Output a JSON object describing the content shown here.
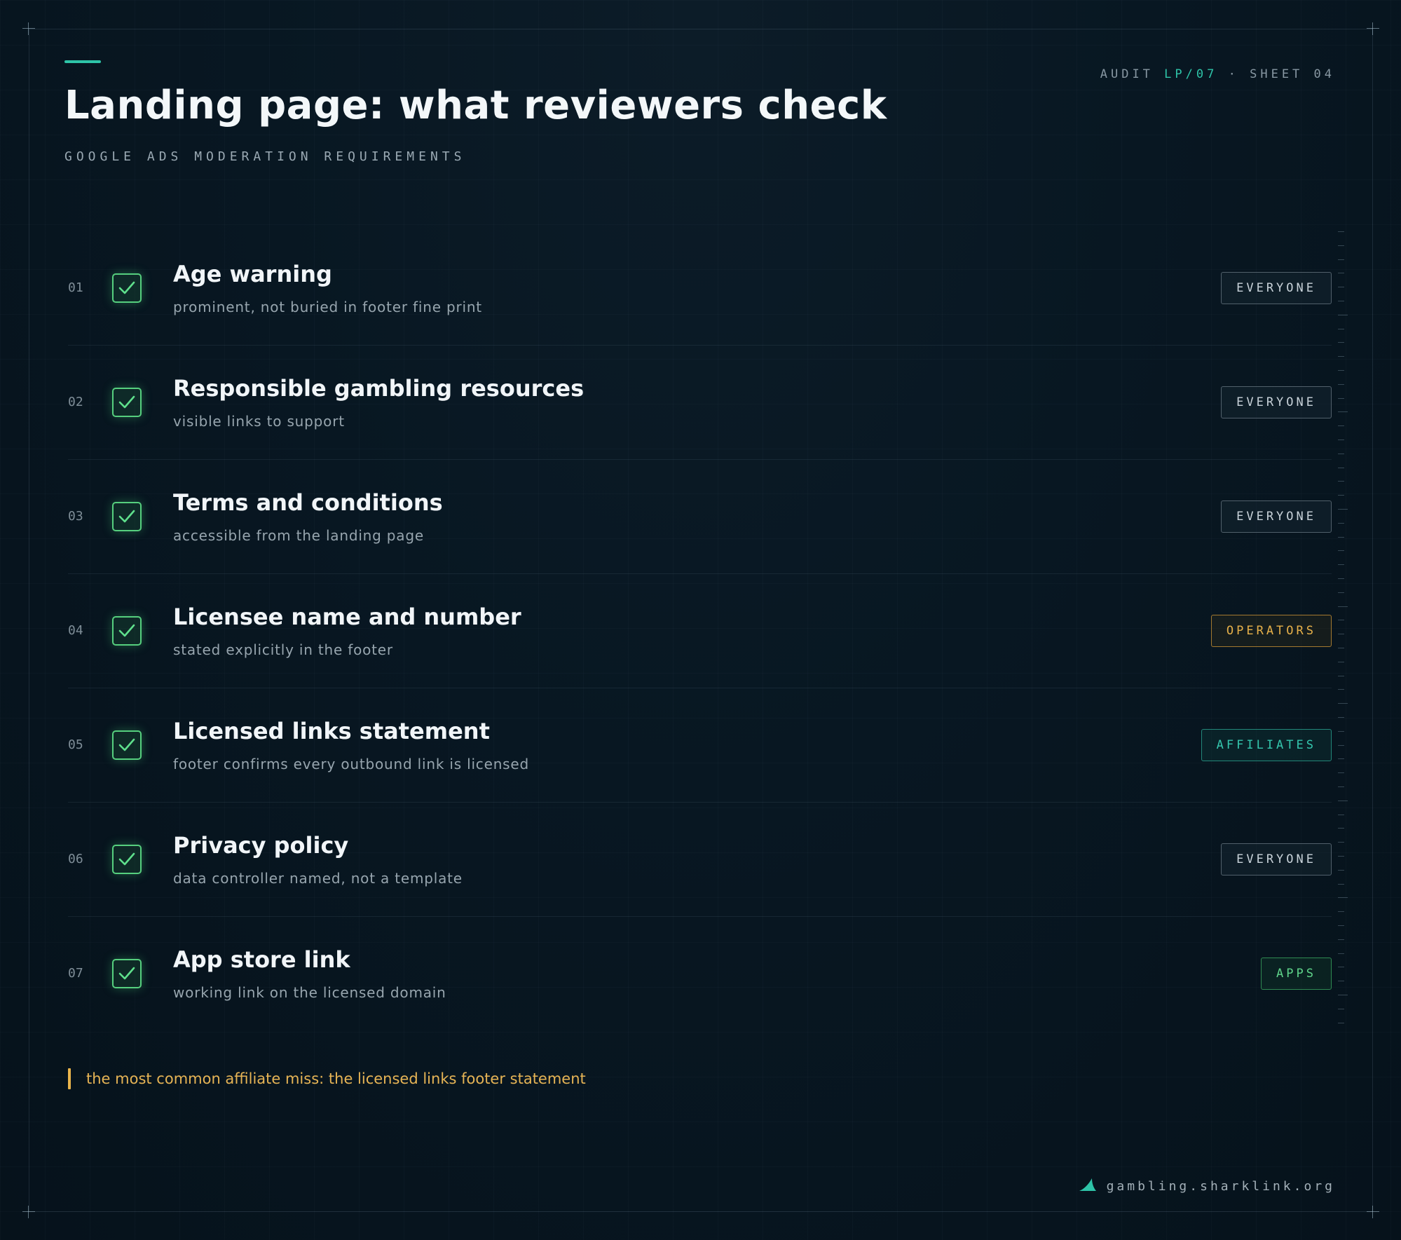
{
  "header": {
    "title": "Landing page: what reviewers check",
    "subtitle": "GOOGLE ADS MODERATION REQUIREMENTS",
    "audit_label": "AUDIT",
    "audit_code": "LP/07",
    "audit_separator": "·",
    "sheet_label": "SHEET 04"
  },
  "items": [
    {
      "num": "01",
      "title": "Age warning",
      "desc": "prominent, not buried in footer fine print",
      "tag": "EVERYONE",
      "checked": true
    },
    {
      "num": "02",
      "title": "Responsible gambling resources",
      "desc": "visible links to support",
      "tag": "EVERYONE",
      "checked": true
    },
    {
      "num": "03",
      "title": "Terms and conditions",
      "desc": "accessible from the landing page",
      "tag": "EVERYONE",
      "checked": true
    },
    {
      "num": "04",
      "title": "Licensee name and number",
      "desc": "stated explicitly in the footer",
      "tag": "OPERATORS",
      "checked": true
    },
    {
      "num": "05",
      "title": "Licensed links statement",
      "desc": "footer confirms every outbound link is licensed",
      "tag": "AFFILIATES",
      "checked": true
    },
    {
      "num": "06",
      "title": "Privacy policy",
      "desc": "data controller named, not a template",
      "tag": "EVERYONE",
      "checked": true
    },
    {
      "num": "07",
      "title": "App store link",
      "desc": "working link on the licensed domain",
      "tag": "APPS",
      "checked": true
    }
  ],
  "note": "the most common affiliate miss: the licensed links footer statement",
  "footer": {
    "domain": "gambling.sharklink.org",
    "logo_icon": "shark-fin-icon"
  },
  "colors": {
    "accent": "#2ec4a8",
    "check": "#56cf7e",
    "everyone": "#c9d3da",
    "operators": "#e7b14a",
    "affiliates": "#34c7ae",
    "apps": "#5fd48a",
    "note": "#e6b455"
  }
}
